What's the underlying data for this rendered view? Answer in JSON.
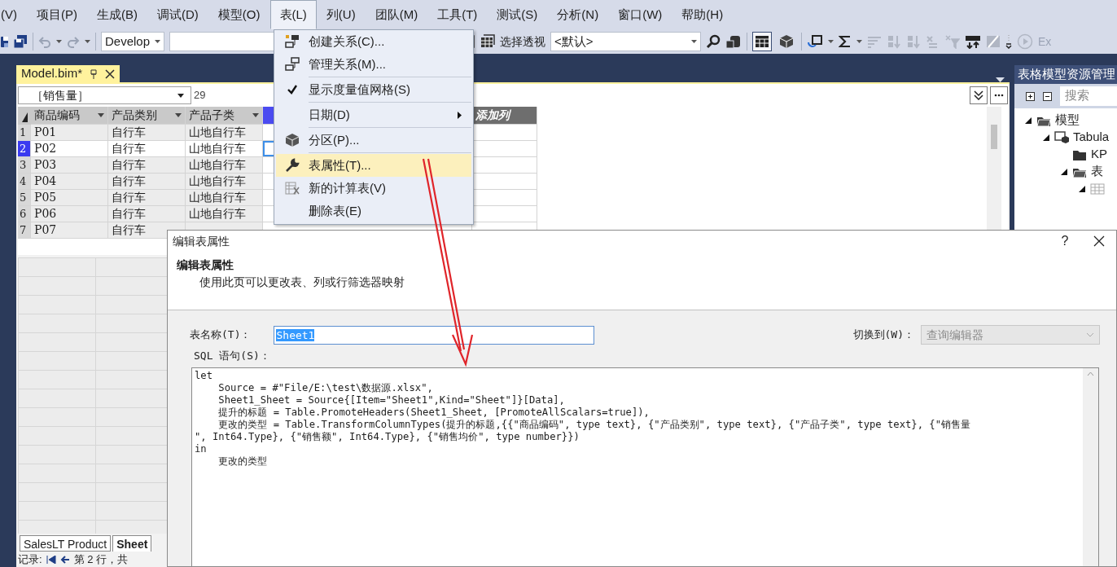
{
  "menu_bar": [
    {
      "label": "(V)",
      "selected": false
    },
    {
      "label": "项目(P)",
      "selected": false
    },
    {
      "label": "生成(B)",
      "selected": false
    },
    {
      "label": "调试(D)",
      "selected": false
    },
    {
      "label": "模型(O)",
      "selected": false
    },
    {
      "label": "表(L)",
      "selected": true
    },
    {
      "label": "列(U)",
      "selected": false
    },
    {
      "label": "团队(M)",
      "selected": false
    },
    {
      "label": "工具(T)",
      "selected": false
    },
    {
      "label": "测试(S)",
      "selected": false
    },
    {
      "label": "分析(N)",
      "selected": false
    },
    {
      "label": "窗口(W)",
      "selected": false
    },
    {
      "label": "帮助(H)",
      "selected": false
    }
  ],
  "toolbar": {
    "configuration": "Develop",
    "perspective_label": "选择透视",
    "perspective": "<默认>",
    "view_buttons": [
      {
        "selected": true
      },
      {
        "selected": false
      }
    ],
    "overflow_text": "Ex"
  },
  "document_tab": {
    "title": "Model.bim*"
  },
  "formula_bar": {
    "measure": "［销售量］",
    "value": "29"
  },
  "grid": {
    "columns": [
      {
        "kind": "data",
        "label": "商品编码",
        "selected": false
      },
      {
        "kind": "data",
        "label": "产品类别",
        "selected": false
      },
      {
        "kind": "data",
        "label": "产品子类",
        "selected": false
      },
      {
        "kind": "data",
        "selected": true
      },
      {
        "kind": "add",
        "label": "添加列",
        "selected": false
      }
    ],
    "rows": [
      {
        "number": "1",
        "selected": false,
        "cells": [
          "P01",
          "自行车",
          "山地自行车"
        ]
      },
      {
        "number": "2",
        "selected": true,
        "cells": [
          "P02",
          "自行车",
          "山地自行车"
        ]
      },
      {
        "number": "3",
        "selected": false,
        "cells": [
          "P03",
          "自行车",
          "山地自行车"
        ]
      },
      {
        "number": "4",
        "selected": false,
        "cells": [
          "P04",
          "自行车",
          "山地自行车"
        ]
      },
      {
        "number": "5",
        "selected": false,
        "cells": [
          "P05",
          "自行车",
          "山地自行车"
        ]
      },
      {
        "number": "6",
        "selected": false,
        "cells": [
          "P06",
          "自行车",
          "山地自行车"
        ]
      },
      {
        "number": "7",
        "selected": false,
        "cells": [
          "P07",
          "自行车"
        ]
      }
    ]
  },
  "sheet_tabs": [
    {
      "label": "SalesLT Product",
      "selected": false
    },
    {
      "label": "Sheet",
      "selected": true
    }
  ],
  "record_bar": {
    "label": "记录:",
    "position": "第 2 行，共"
  },
  "table_menu": [
    {
      "kind": "item",
      "label": "创建关系(C)...",
      "checked": false,
      "selected": false
    },
    {
      "kind": "item",
      "label": "管理关系(M)...",
      "checked": false,
      "selected": false
    },
    {
      "kind": "separator"
    },
    {
      "kind": "item",
      "label": "显示度量值网格(S)",
      "checked": true,
      "selected": false
    },
    {
      "kind": "separator"
    },
    {
      "kind": "submenu",
      "label": "日期(D)",
      "checked": false,
      "selected": false
    },
    {
      "kind": "separator"
    },
    {
      "kind": "item",
      "label": "分区(P)...",
      "checked": false,
      "selected": false
    },
    {
      "kind": "separator"
    },
    {
      "kind": "item",
      "label": "表属性(T)...",
      "checked": false,
      "selected": true
    },
    {
      "kind": "item",
      "label": "新的计算表(V)",
      "checked": false,
      "selected": false
    },
    {
      "kind": "item",
      "label": "删除表(E)",
      "checked": false,
      "selected": false
    }
  ],
  "explorer": {
    "title": "表格模型资源管理",
    "search_placeholder": "搜索",
    "tree": [
      {
        "kind": "model",
        "label": "模型",
        "expanded": true,
        "children": [
          {
            "kind": "data-source",
            "label": "Tabula",
            "expanded": true,
            "children": [
              {
                "kind": "folder",
                "label": "KP"
              },
              {
                "kind": "folder-open",
                "label": "表",
                "expanded": true,
                "children": [
                  {
                    "kind": "table",
                    "expanded": true
                  }
                ]
              }
            ]
          }
        ]
      }
    ]
  },
  "dialog": {
    "title": "编辑表属性",
    "help": "?",
    "heading": "编辑表属性",
    "description": "使用此页可以更改表、列或行筛选器映射",
    "table_name_label": "表名称(T)：",
    "table_name": "Sheet1",
    "switch_label": "切换到(W)：",
    "switch_value": "查询编辑器",
    "switch_disabled": true,
    "sql_label": "SQL 语句(S)：",
    "sql_lines": [
      "let",
      "    Source = #\"File/E:\\test\\数据源.xlsx\",",
      "    Sheet1_Sheet = Source{[Item=\"Sheet1\",Kind=\"Sheet\"]}[Data],",
      "    提升的标题 = Table.PromoteHeaders(Sheet1_Sheet, [PromoteAllScalars=true]),",
      "    更改的类型 = Table.TransformColumnTypes(提升的标题,{{\"商品编码\", type text}, {\"产品类别\", type text}, {\"产品子类\", type text}, {\"销售量",
      "\", Int64.Type}, {\"销售额\", Int64.Type}, {\"销售均价\", type number}})",
      "in",
      "    更改的类型"
    ]
  }
}
